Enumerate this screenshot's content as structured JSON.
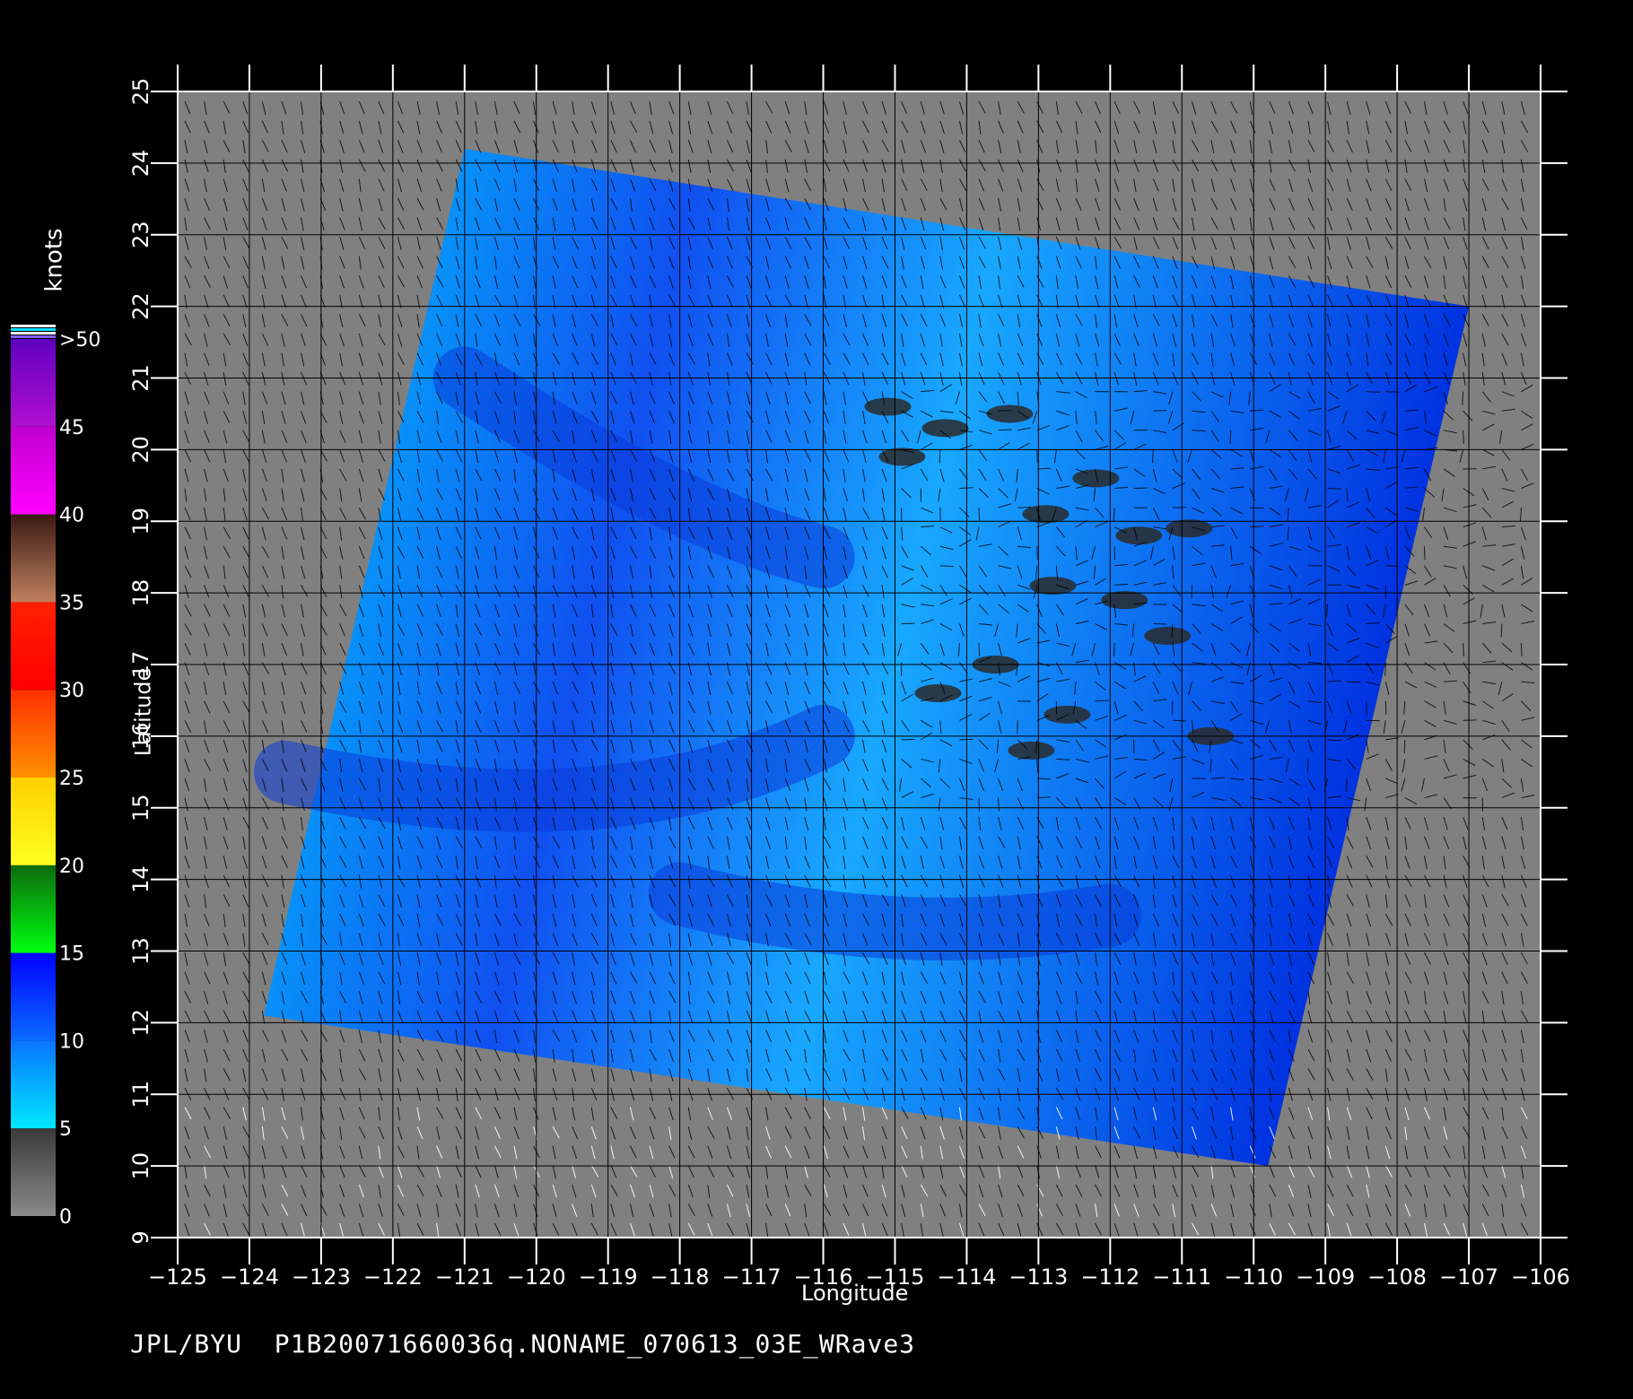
{
  "footer": {
    "credit": "JPL/BYU",
    "filename": "P1B20071660036q.NONAME_070613_03E_WRave3"
  },
  "axes": {
    "xlabel": "Longitude",
    "ylabel": "Latitude",
    "xlim": [
      -125,
      -106
    ],
    "ylim": [
      9,
      25
    ],
    "xticks": [
      "-125",
      "-124",
      "-123",
      "-122",
      "-121",
      "-120",
      "-119",
      "-118",
      "-117",
      "-116",
      "-115",
      "-114",
      "-113",
      "-112",
      "-111",
      "-110",
      "-109",
      "-108",
      "-107",
      "-106"
    ],
    "yticks": [
      "9",
      "10",
      "11",
      "12",
      "13",
      "14",
      "15",
      "16",
      "17",
      "18",
      "19",
      "20",
      "21",
      "22",
      "23",
      "24",
      "25"
    ]
  },
  "colorbar": {
    "title": "knots",
    "labels": [
      "0",
      "5",
      "10",
      "15",
      "20",
      "25",
      "30",
      "35",
      "40",
      "45",
      ">50"
    ],
    "bands": [
      {
        "from": 0,
        "to": 5,
        "top": "#3a3a3a",
        "bottom": "#8a8a8a"
      },
      {
        "from": 5,
        "to": 10,
        "top": "#0a74ff",
        "bottom": "#00e8ff"
      },
      {
        "from": 10,
        "to": 15,
        "top": "#0000ff",
        "bottom": "#0a6cff"
      },
      {
        "from": 15,
        "to": 20,
        "top": "#0d6b0d",
        "bottom": "#00ff10"
      },
      {
        "from": 20,
        "to": 25,
        "top": "#ffd000",
        "bottom": "#ffff20"
      },
      {
        "from": 25,
        "to": 30,
        "top": "#ff3000",
        "bottom": "#ff9000"
      },
      {
        "from": 30,
        "to": 35,
        "top": "#ff2000",
        "bottom": "#ff0000"
      },
      {
        "from": 35,
        "to": 40,
        "top": "#3a1a12",
        "bottom": "#c08060"
      },
      {
        "from": 40,
        "to": 45,
        "top": "#c000d0",
        "bottom": "#ff00ff"
      },
      {
        "from": 45,
        "to": 50,
        "top": "#6000c0",
        "bottom": "#b010d0"
      }
    ]
  },
  "map_data": {
    "swath_corners_lonlat": [
      [
        -121.0,
        24.2
      ],
      [
        -107.0,
        22.0
      ],
      [
        -109.8,
        10.0
      ],
      [
        -123.8,
        12.1
      ]
    ],
    "background_color": "#808080",
    "swath_low_wind_color": "#00c8ff",
    "swath_high_wind_color": "#0030e0",
    "rain_flag_color": "#2a2a2a"
  }
}
